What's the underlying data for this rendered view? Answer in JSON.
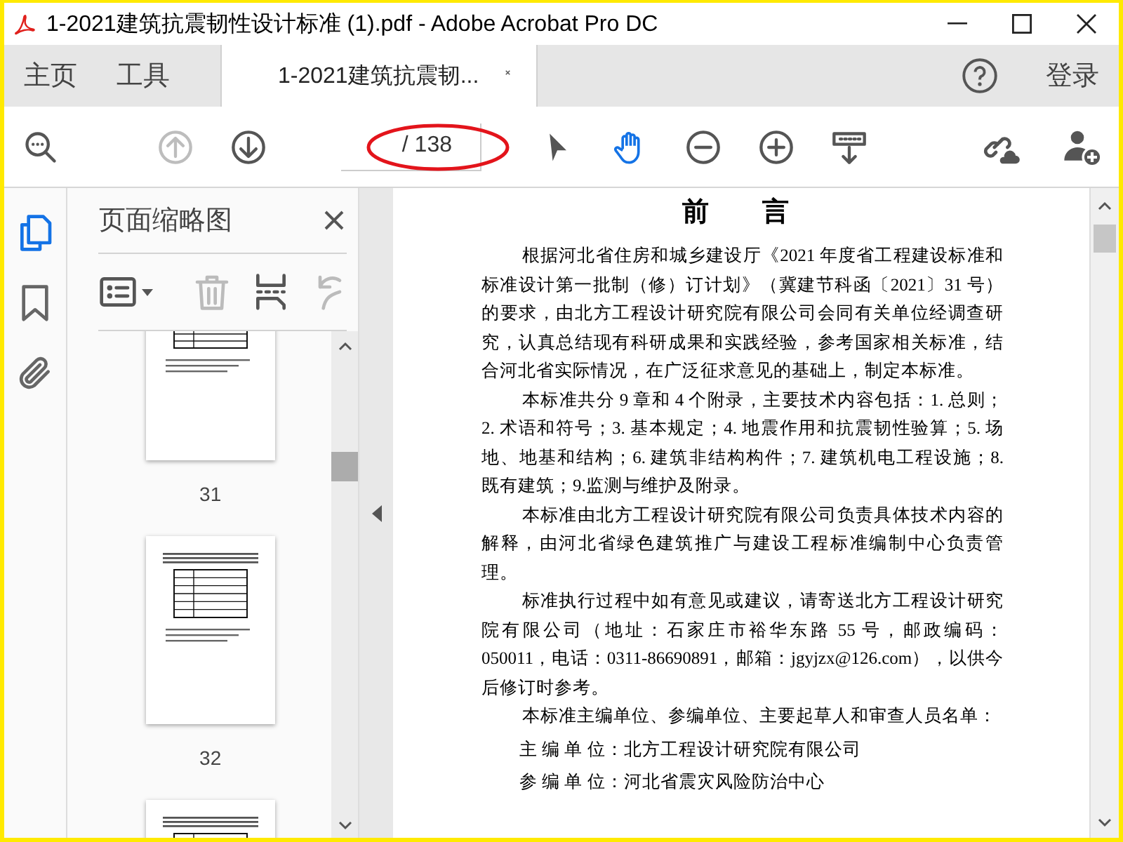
{
  "window": {
    "title": "1-2021建筑抗震韧性设计标准 (1).pdf - Adobe Acrobat Pro DC"
  },
  "tabs": [
    {
      "label": "主页",
      "kind": "nav",
      "selected": false
    },
    {
      "label": "工具",
      "kind": "nav",
      "selected": false
    },
    {
      "label": "1-2021建筑抗震韧...",
      "kind": "document",
      "selected": true
    }
  ],
  "sign_in": "登录",
  "toolbar": {
    "left": [
      {
        "kind": "find",
        "disabled": false
      },
      {
        "kind": "previous-page",
        "disabled": true
      },
      {
        "kind": "next-page",
        "disabled": false
      }
    ],
    "page_count": "/ 138",
    "tools": [
      {
        "kind": "select",
        "selected": false
      },
      {
        "kind": "hand",
        "selected": true
      },
      {
        "kind": "zoom-out",
        "selected": false
      },
      {
        "kind": "zoom-in",
        "selected": false
      },
      {
        "kind": "fit",
        "selected": false
      }
    ],
    "right": [
      {
        "kind": "share-link"
      },
      {
        "kind": "add-user"
      }
    ]
  },
  "sidebar": {
    "rail": [
      {
        "kind": "pages",
        "selected": true
      },
      {
        "kind": "bookmarks",
        "selected": false
      },
      {
        "kind": "attachments",
        "selected": false
      }
    ],
    "title": "页面缩略图",
    "actions": [
      {
        "kind": "options",
        "disabled": false
      },
      {
        "kind": "delete",
        "disabled": true
      },
      {
        "kind": "insert",
        "disabled": false
      },
      {
        "kind": "rotate",
        "disabled": true
      }
    ],
    "thumbnails": [
      {
        "label": "31"
      },
      {
        "label": "32"
      },
      {
        "cut": true
      }
    ]
  },
  "document": {
    "heading": "前　　言",
    "paragraphs": [
      {
        "kind": "para",
        "text": "根据河北省住房和城乡建设厅《2021 年度省工程建设标准和标准设计第一批制（修）订计划》（冀建节科函〔2021〕31 号）的要求，由北方工程设计研究院有限公司会同有关单位经调查研究，认真总结现有科研成果和实践经验，参考国家相关标准，结合河北省实际情况，在广泛征求意见的基础上，制定本标准。"
      },
      {
        "kind": "para",
        "text": "本标准共分 9 章和 4 个附录，主要技术内容包括：1. 总则；2. 术语和符号；3. 基本规定；4. 地震作用和抗震韧性验算；5. 场地、地基和结构；6. 建筑非结构构件；7. 建筑机电工程设施；8. 既有建筑；9.监测与维护及附录。"
      },
      {
        "kind": "para",
        "text": "本标准由北方工程设计研究院有限公司负责具体技术内容的解释，由河北省绿色建筑推广与建设工程标准编制中心负责管理。"
      },
      {
        "kind": "para",
        "text": "标准执行过程中如有意见或建议，请寄送北方工程设计研究院有限公司（地址：石家庄市裕华东路 55 号，邮政编码：050011，电话：0311-86690891，邮箱：jgyjzx@126.com），以供今后修订时参考。"
      },
      {
        "kind": "para",
        "text": "本标准主编单位、参编单位、主要起草人和审查人员名单："
      },
      {
        "kind": "unit",
        "label": "主 编 单 位：",
        "text": "北方工程设计研究院有限公司"
      },
      {
        "kind": "unit",
        "label": "参 编 单 位：",
        "text": "河北省震灾风险防治中心"
      }
    ]
  }
}
